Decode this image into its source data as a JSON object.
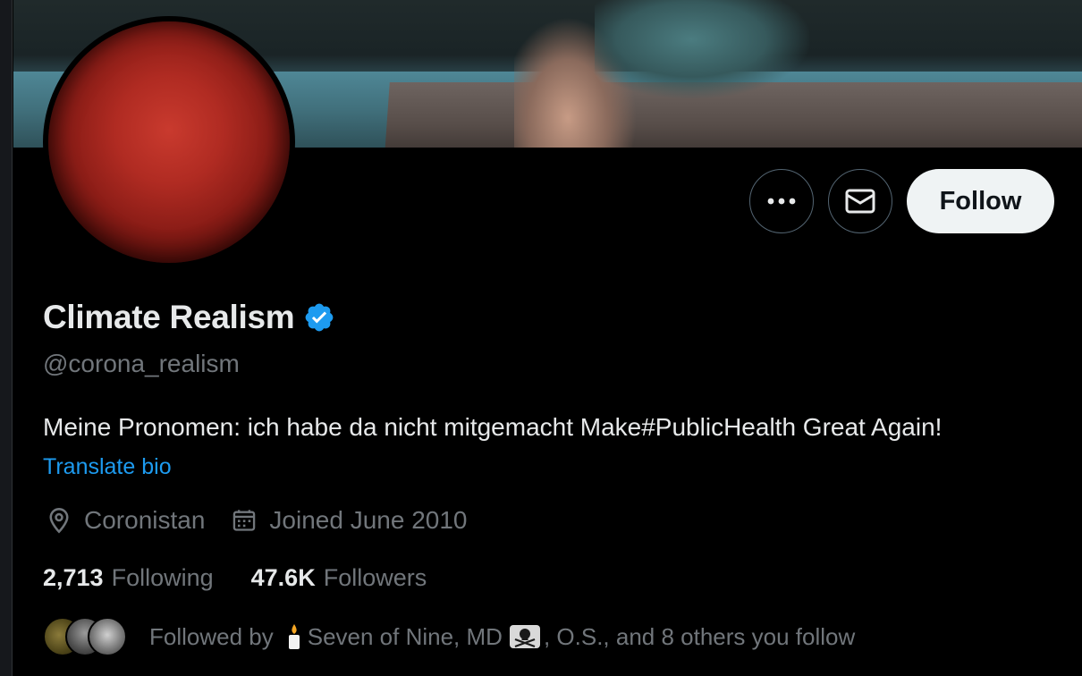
{
  "profile": {
    "name": "Climate Realism",
    "handle": "@corona_realism",
    "bio": "Meine Pronomen: ich habe da nicht mitgemacht Make#PublicHealth Great Again!",
    "translate_label": "Translate bio",
    "location": "Coronistan",
    "joined": "Joined June 2010",
    "verified": true
  },
  "actions": {
    "follow_label": "Follow",
    "more_icon": "more-horizontal-icon",
    "message_icon": "envelope-icon"
  },
  "stats": {
    "following_count": "2,713",
    "following_label": "Following",
    "followers_count": "47.6K",
    "followers_label": "Followers"
  },
  "followed_by": {
    "prefix": "Followed by",
    "name1": "Seven of Nine, MD",
    "rest": ", O.S., and 8 others you follow"
  },
  "colors": {
    "accent": "#1d9bf0",
    "background": "#000000",
    "secondary_text": "#71767b"
  }
}
